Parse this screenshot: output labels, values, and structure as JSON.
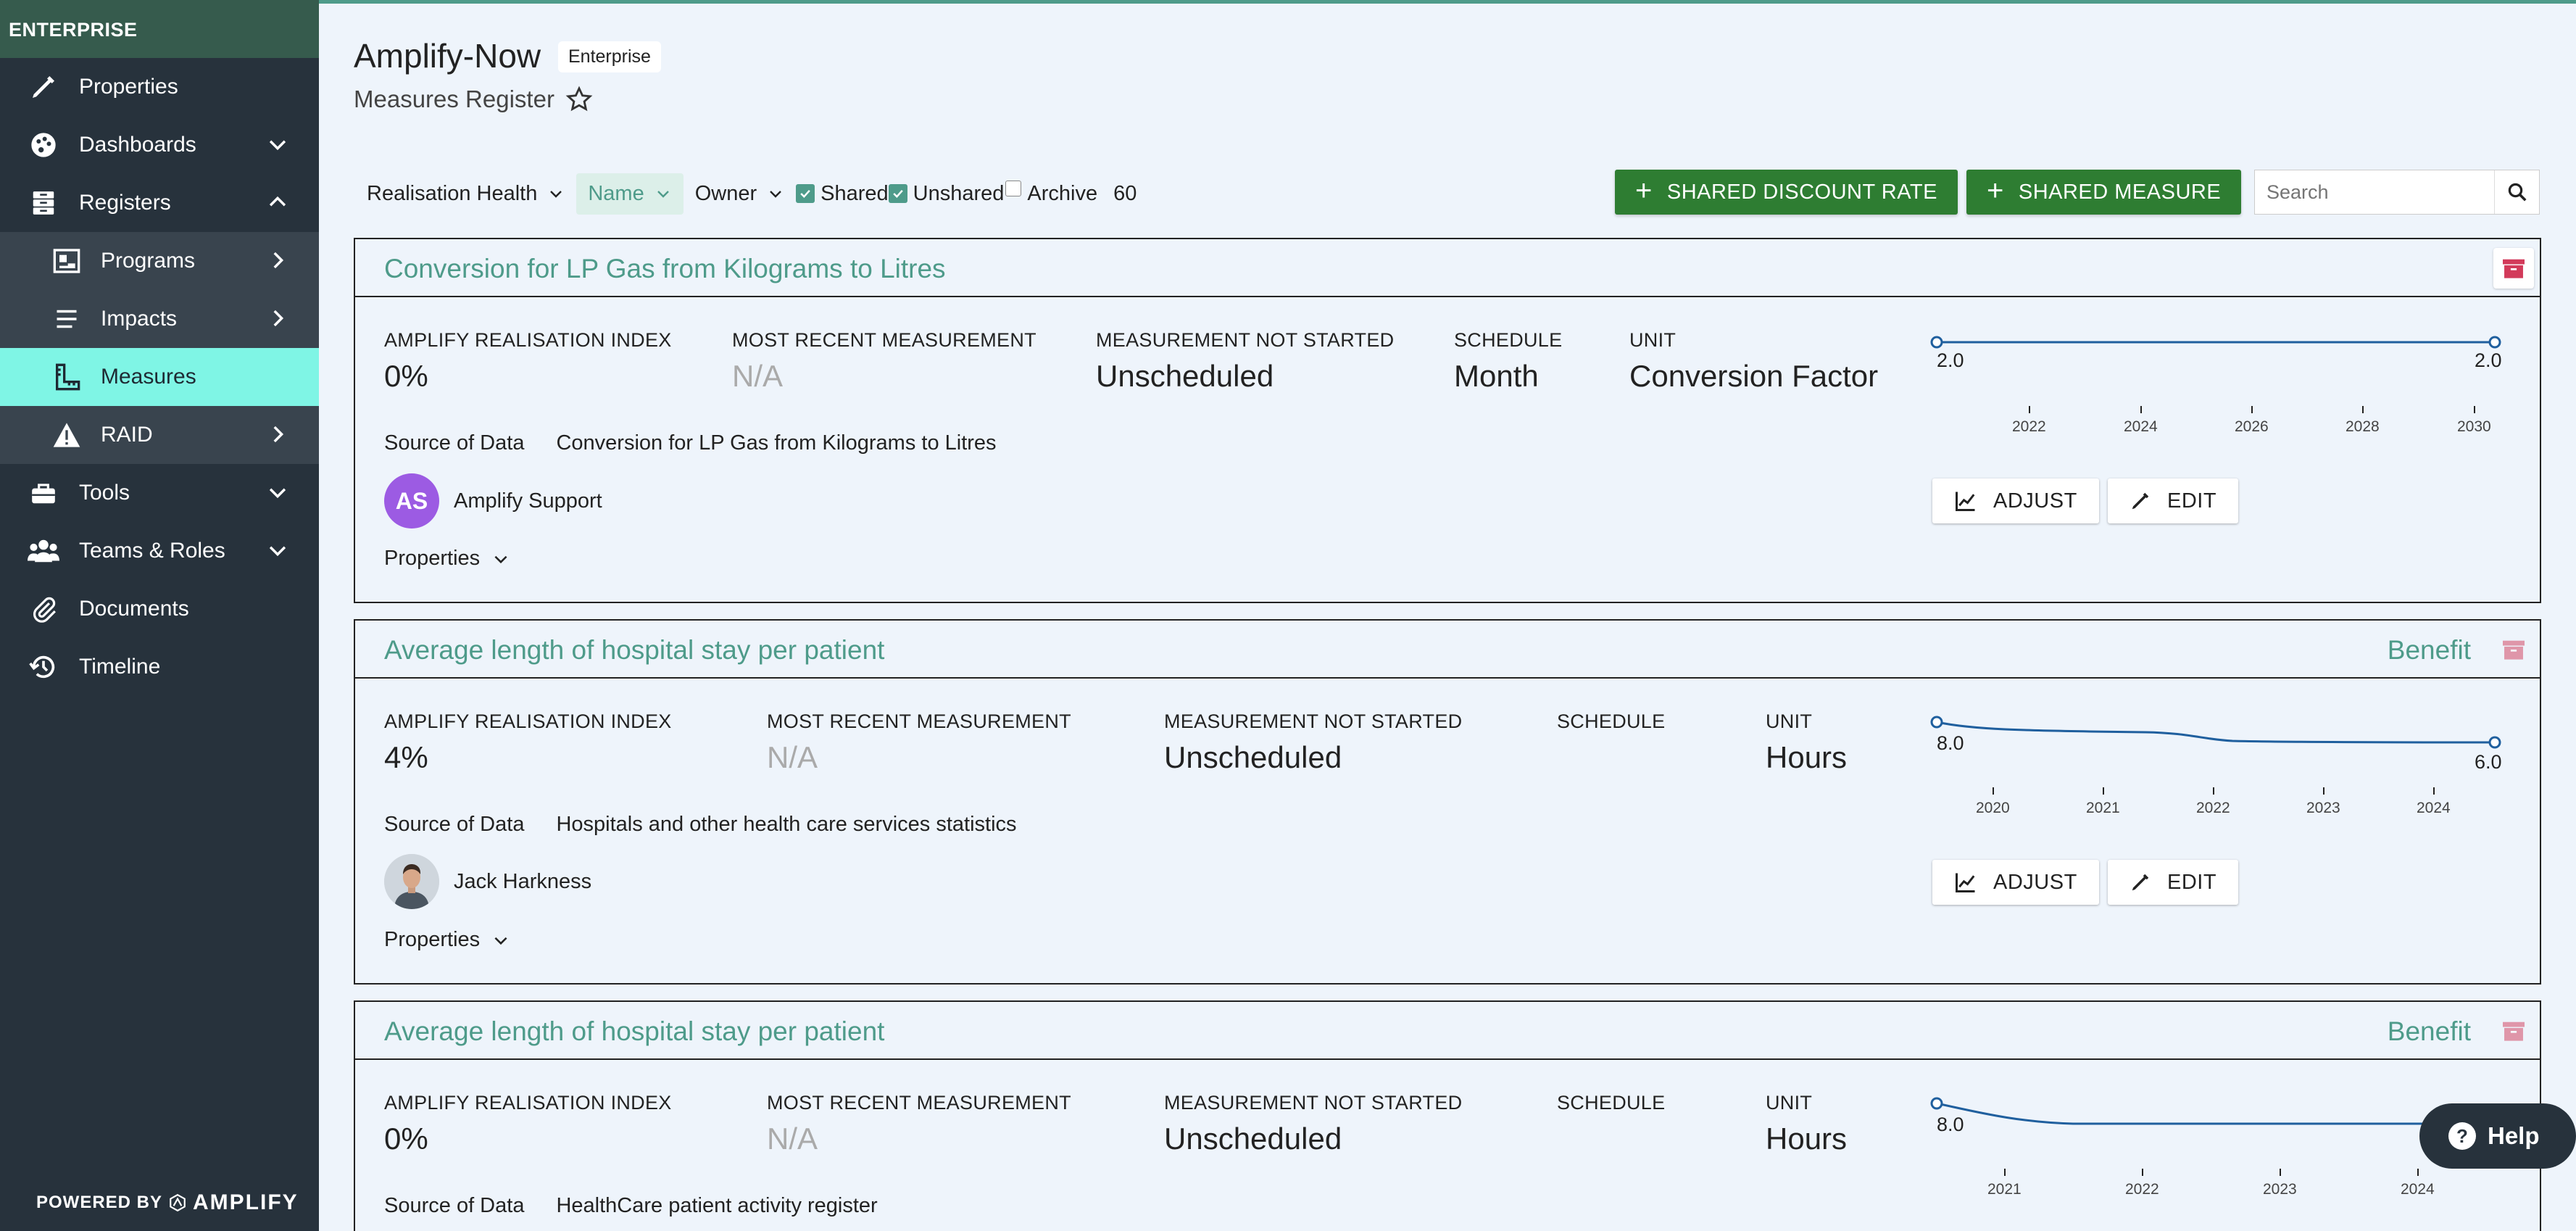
{
  "sidebar": {
    "brand": "ENTERPRISE",
    "items": [
      {
        "label": "Properties",
        "icon": "pencil-icon"
      },
      {
        "label": "Dashboards",
        "icon": "palette-icon"
      },
      {
        "label": "Registers",
        "icon": "registers-icon"
      },
      {
        "label": "Programs",
        "icon": "programs-icon"
      },
      {
        "label": "Impacts",
        "icon": "list-icon"
      },
      {
        "label": "Measures",
        "icon": "ruler-icon"
      },
      {
        "label": "RAID",
        "icon": "warning-icon"
      },
      {
        "label": "Tools",
        "icon": "toolbox-icon"
      },
      {
        "label": "Teams & Roles",
        "icon": "users-icon"
      },
      {
        "label": "Documents",
        "icon": "paperclip-icon"
      },
      {
        "label": "Timeline",
        "icon": "history-icon"
      }
    ],
    "powered_by": "POWERED BY",
    "powered_brand": "AMPLIFY"
  },
  "header": {
    "app_title": "Amplify-Now",
    "env_badge": "Enterprise",
    "page_title": "Measures Register"
  },
  "filters": {
    "realisation_health": "Realisation Health",
    "name": "Name",
    "owner": "Owner",
    "shared": "Shared",
    "unshared": "Unshared",
    "archive": "Archive",
    "count": "60"
  },
  "actions": {
    "shared_discount_rate": "SHARED DISCOUNT RATE",
    "shared_measure": "SHARED MEASURE",
    "search_placeholder": "Search"
  },
  "labels": {
    "ari": "AMPLIFY REALISATION INDEX",
    "recent": "MOST RECENT MEASUREMENT",
    "not_started": "MEASUREMENT NOT STARTED",
    "schedule": "SCHEDULE",
    "unit": "UNIT",
    "source": "Source of Data",
    "properties": "Properties",
    "adjust": "ADJUST",
    "edit": "EDIT"
  },
  "cards": [
    {
      "title": "Conversion for LP Gas from Kilograms to Litres",
      "category": "",
      "ari": "0%",
      "recent": "N/A",
      "not_started": "Unscheduled",
      "schedule": "Month",
      "unit": "Conversion Factor",
      "source": "Conversion for LP Gas from Kilograms to Litres",
      "owner": "Amplify Support",
      "owner_initials": "AS",
      "chart": {
        "start_label": "2.0",
        "end_label": "2.0",
        "years": [
          "2022",
          "2024",
          "2026",
          "2028",
          "2030"
        ]
      }
    },
    {
      "title": "Average length of hospital stay per patient",
      "category": "Benefit",
      "ari": "4%",
      "recent": "N/A",
      "not_started": "Unscheduled",
      "schedule": "",
      "unit": "Hours",
      "source": "Hospitals and other health care services statistics",
      "owner": "Jack Harkness",
      "chart": {
        "start_label": "8.0",
        "end_label": "6.0",
        "years": [
          "2020",
          "2021",
          "2022",
          "2023",
          "2024"
        ]
      }
    },
    {
      "title": "Average length of hospital stay per patient",
      "category": "Benefit",
      "ari": "0%",
      "recent": "N/A",
      "not_started": "Unscheduled",
      "schedule": "",
      "unit": "Hours",
      "source": "HealthCare patient activity register",
      "chart": {
        "start_label": "8.0",
        "years": [
          "2021",
          "2022",
          "2023",
          "2024"
        ]
      }
    }
  ],
  "help": "Help",
  "colors": {
    "accent": "#4e9b8a",
    "sidebar": "#27323c",
    "active": "#7ff5e5",
    "primary_button": "#2e7d32",
    "archive": "#d23a5a"
  }
}
